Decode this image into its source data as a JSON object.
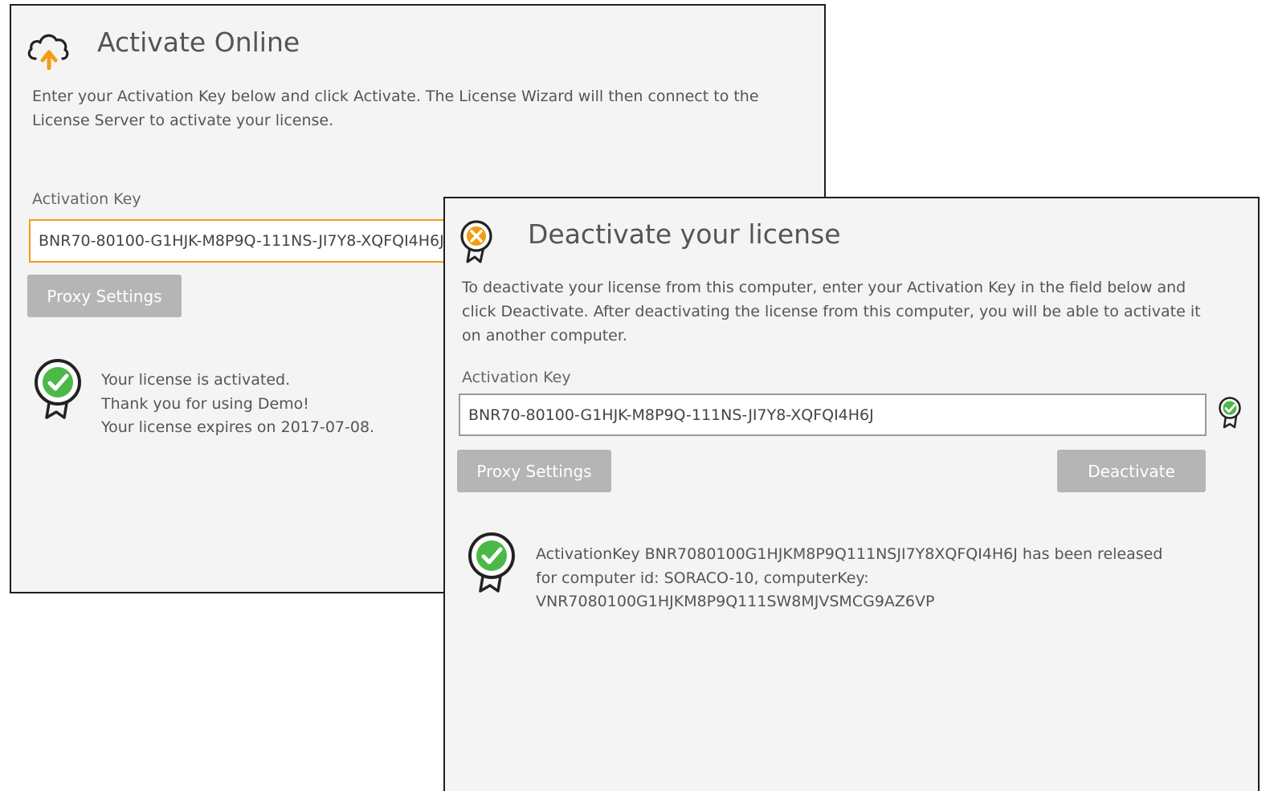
{
  "activate_panel": {
    "title": "Activate Online",
    "description": "Enter your Activation Key below and click Activate. The License Wizard will then connect to the License Server to activate your license.",
    "activation_key_label": "Activation Key",
    "activation_key_value": "BNR70-80100-G1HJK-M8P9Q-111NS-JI7Y8-XQFQI4H6J",
    "proxy_settings_label": "Proxy Settings",
    "status_lines": [
      "Your license is activated.",
      "Thank you for using Demo!",
      "Your license expires on 2017-07-08."
    ],
    "icons": {
      "title": "cloud-upload-icon",
      "status": "certificate-check-icon"
    }
  },
  "deactivate_panel": {
    "title": "Deactivate your license",
    "description": "To deactivate your license from this computer, enter your Activation Key in the field below and click Deactivate. After deactivating the license from this computer, you will be able to activate it on another computer.",
    "activation_key_label": "Activation Key",
    "activation_key_value": "BNR70-80100-G1HJK-M8P9Q-111NS-JI7Y8-XQFQI4H6J",
    "proxy_settings_label": "Proxy Settings",
    "deactivate_label": "Deactivate",
    "status_lines": [
      "ActivationKey BNR7080100G1HJKM8P9Q111NSJI7Y8XQFQI4H6J has been released",
      "for computer id: SORACO-10, computerKey:",
      "VNR7080100G1HJKM8P9Q111SW8MJVSMCG9AZ6VP"
    ],
    "icons": {
      "title": "certificate-x-icon",
      "field_valid": "certificate-check-icon",
      "status": "certificate-check-icon"
    }
  },
  "colors": {
    "accent_orange": "#f39c12",
    "success_green": "#4cb848",
    "button_gray": "#b5b5b5",
    "panel_bg": "#f4f4f4"
  }
}
